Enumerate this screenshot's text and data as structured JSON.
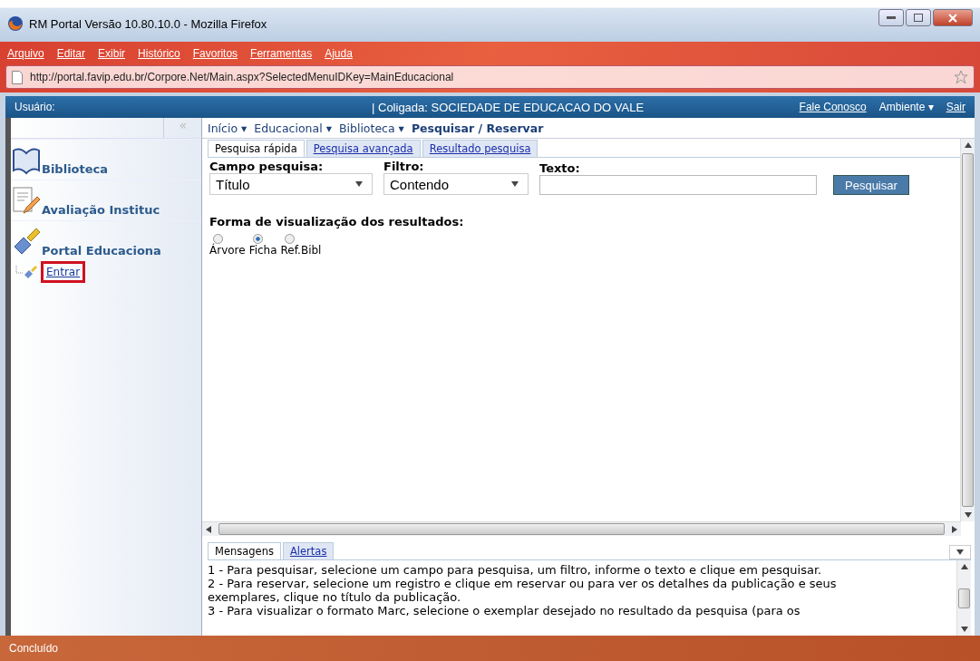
{
  "window": {
    "title": "RM Portal Versão 10.80.10.0 - Mozilla Firefox"
  },
  "menu": [
    "Arquivo",
    "Editar",
    "Exibir",
    "Histórico",
    "Favoritos",
    "Ferramentas",
    "Ajuda"
  ],
  "address": {
    "value": "http://portal.favip.edu.br/Corpore.Net/Main.aspx?SelectedMenuIDKey=MainEducacional"
  },
  "portal_header": {
    "user_label": "Usuário:",
    "coligada": "| Coligada: SOCIEDADE DE EDUCACAO DO VALE",
    "contact_link": "Fale Conosco",
    "environment": "Ambiente ▾",
    "logout_link": "Sair"
  },
  "sidebar": {
    "collapse": "«",
    "items": [
      {
        "label": "Biblioteca",
        "kind": "book"
      },
      {
        "label": "Avaliação Instituc",
        "kind": "doc"
      },
      {
        "label": "Portal Educaciona",
        "kind": "brush",
        "children": [
          {
            "label": "Entrar",
            "highlighted": true
          }
        ]
      }
    ]
  },
  "breadcrumb": [
    {
      "label": "Início ▾",
      "current": false
    },
    {
      "label": "Educacional ▾",
      "current": false
    },
    {
      "label": "Biblioteca ▾",
      "current": false
    },
    {
      "label": "Pesquisar / Reservar",
      "current": true
    }
  ],
  "tabs": [
    {
      "label": "Pesquisa rápida",
      "selected": true
    },
    {
      "label": "Pesquisa avançada",
      "selected": false
    },
    {
      "label": "Resultado pesquisa",
      "selected": false
    }
  ],
  "form": {
    "field_label": "Campo pesquisa:",
    "field_value": "Título",
    "filter_label": "Filtro:",
    "filter_value": "Contendo",
    "text_label": "Texto:",
    "search_button": "Pesquisar",
    "view_label": "Forma de visualização dos resultados:",
    "view_options": [
      {
        "label": "Árvore",
        "selected": false
      },
      {
        "label": "Ficha",
        "selected": true
      },
      {
        "label": "Ref.Bibl",
        "selected": false
      }
    ]
  },
  "messages": {
    "tabs": [
      {
        "label": "Mensagens",
        "selected": true
      },
      {
        "label": "Alertas",
        "selected": false
      }
    ],
    "lines": [
      "1 - Para pesquisar, selecione um campo para pesquisa, um filtro, informe o texto e clique em pesquisar.",
      "2 - Para reservar, selecione um registro e clique em reservar ou para ver os detalhes da publicação e seus exemplares, clique no título da publicação.",
      "3 - Para visualizar o formato Marc, selecione o exemplar desejado no resultado da pesquisa (para os"
    ]
  },
  "status_bar": "Concluído"
}
